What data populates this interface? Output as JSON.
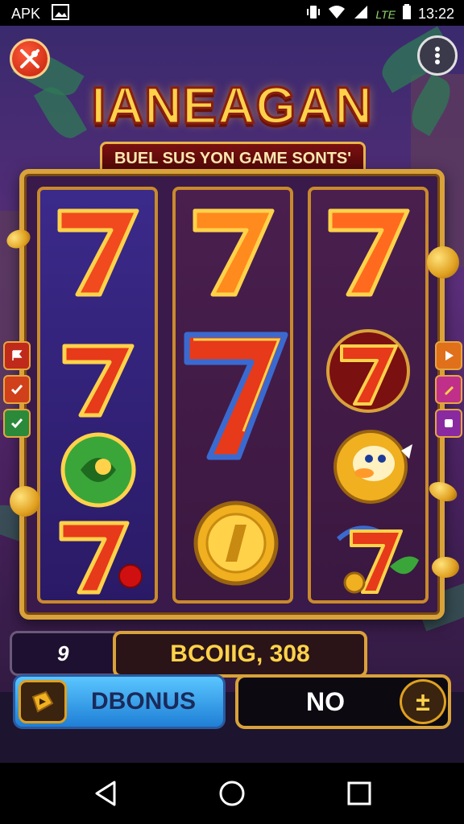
{
  "status_bar": {
    "carrier_label": "APK",
    "network_label": "LTE",
    "time": "13:22",
    "icons": [
      "image-icon",
      "vibrate-icon",
      "wifi-icon",
      "signal-icon",
      "battery-icon"
    ]
  },
  "game": {
    "title": "IANEAGAN",
    "subtitle": "BUEL SUS YON GAME SONTS'",
    "reels": [
      [
        "seven",
        "seven",
        "green-orb",
        "seven-cherry"
      ],
      [
        "seven",
        "big-seven",
        "gold-coin"
      ],
      [
        "seven",
        "seven-badge",
        "duck-coin",
        "fruit-seven"
      ]
    ],
    "left_tabs": [
      "red-flag",
      "red-check",
      "green-check"
    ],
    "right_tabs": [
      "orange-tab",
      "pink-tab",
      "purple-tab"
    ],
    "counter_value": "9",
    "bonus_value": "BCOIIG, 308",
    "buttons": {
      "bonus_label": "DBONUS",
      "no_label": "NO",
      "no_icon_symbol": "±"
    }
  },
  "colors": {
    "gold": "#d9a23a",
    "seven_red": "#e23a1a",
    "accent_blue": "#3aa6f0"
  },
  "nav_bar": {
    "icons": [
      "back-icon",
      "home-icon",
      "recents-icon"
    ]
  }
}
